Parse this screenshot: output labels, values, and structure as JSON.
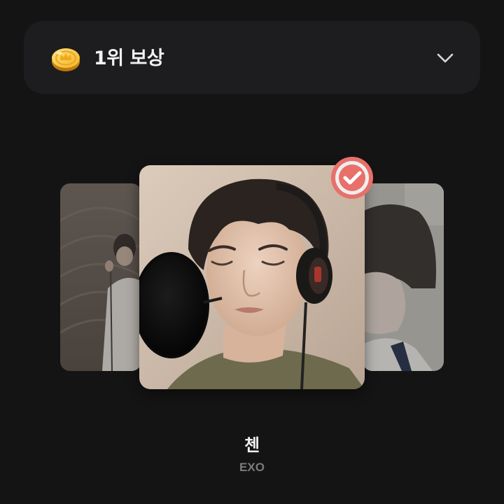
{
  "reward": {
    "title": "1위 보상",
    "coin_icon": "gold-coin-icon",
    "expand_icon": "chevron-down-icon"
  },
  "carousel": {
    "selected": {
      "name": "첸",
      "group": "EXO",
      "selected_icon": "check-circle-icon",
      "badge_color": "#e9706a"
    },
    "side_cards": [
      "previous-artist",
      "next-artist"
    ]
  },
  "colors": {
    "background": "#141414",
    "card": "#1d1d1f",
    "accent": "#e9706a",
    "coin": "#f5c542",
    "muted_text": "#7c7c7c"
  }
}
